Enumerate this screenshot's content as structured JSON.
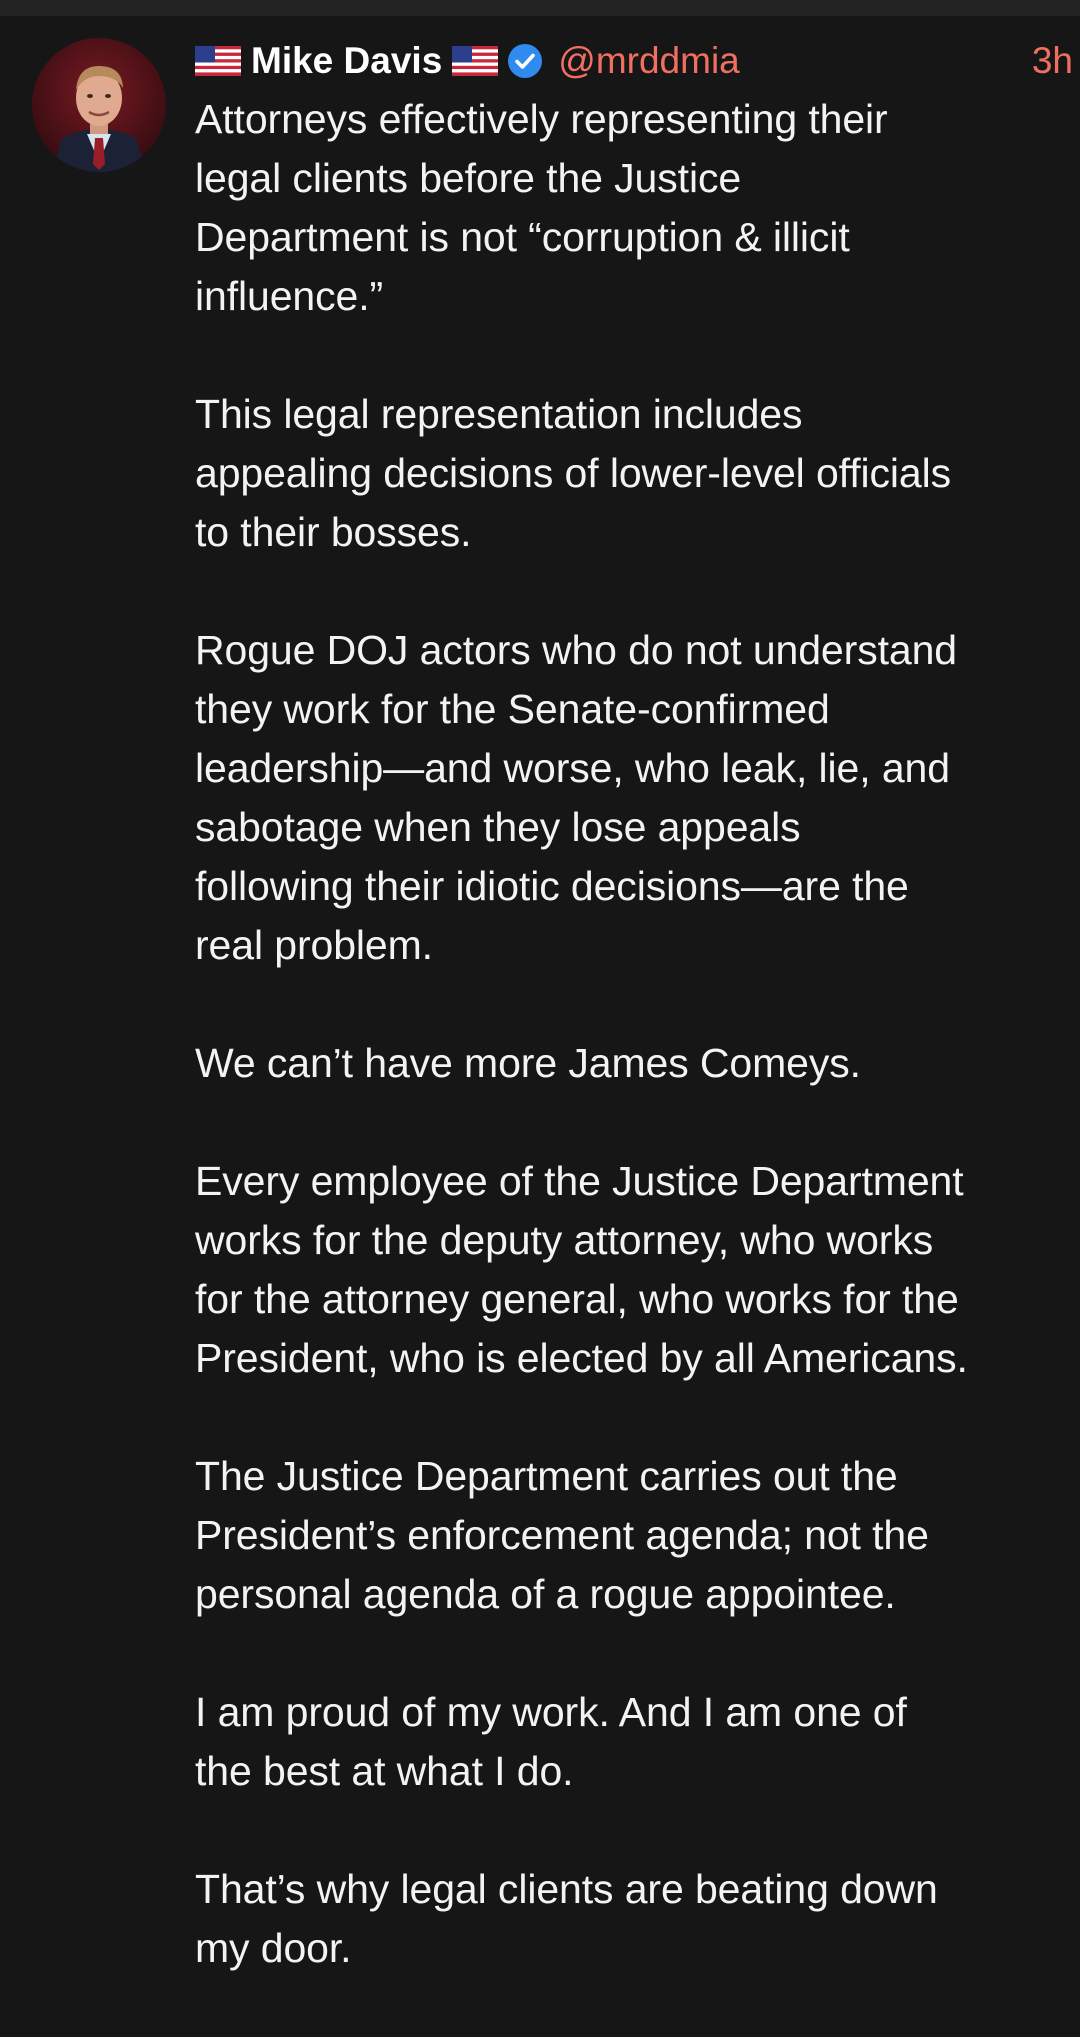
{
  "post": {
    "author_name": "Mike Davis",
    "handle": "@mrddmia",
    "timestamp": "3h",
    "icons": {
      "name_prefix": "us-flag-icon",
      "name_suffix": "us-flag-icon",
      "verified": "verified-badge-icon"
    },
    "colors": {
      "background": "#161616",
      "text": "#f3f3f3",
      "accent": "#f06f60",
      "verified": "#2f8bf0"
    },
    "paragraphs": [
      "Attorneys effectively representing their\nlegal clients before the Justice\nDepartment is not “corruption & illicit\ninfluence.”",
      "This legal representation includes\nappealing decisions of lower-level officials\nto their bosses.",
      "Rogue DOJ actors who do not understand\nthey work for the Senate-confirmed\nleadership—and worse, who leak, lie, and\nsabotage when they lose appeals\nfollowing their idiotic decisions—are the\nreal problem.",
      "We can’t have more James Comeys.",
      "Every employee of the Justice Department\nworks for the deputy attorney, who works\nfor the attorney general, who works for the\nPresident, who is elected by all Americans.",
      "The Justice Department carries out the\nPresident’s enforcement agenda; not the\npersonal agenda of a rogue appointee.",
      "I am proud of my work. And I am one of\nthe best at what I do.",
      "That’s why legal clients are beating down\nmy door."
    ]
  }
}
